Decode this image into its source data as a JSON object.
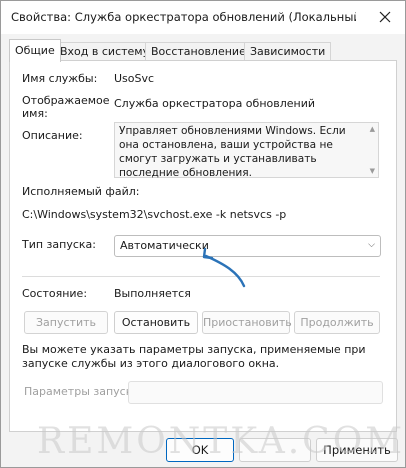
{
  "window": {
    "title": "Свойства: Служба оркестратора обновлений (Локальный компьютер)",
    "close_icon": "close-icon"
  },
  "tabs": [
    {
      "label": "Общие"
    },
    {
      "label": "Вход в систему"
    },
    {
      "label": "Восстановление"
    },
    {
      "label": "Зависимости"
    }
  ],
  "general": {
    "service_name_label": "Имя службы:",
    "service_name_value": "UsoSvc",
    "display_name_label_1": "Отображаемое",
    "display_name_label_2": "имя:",
    "display_name_value": "Служба оркестратора обновлений",
    "description_label": "Описание:",
    "description_value": "Управляет обновлениями Windows. Если она остановлена, ваши устройства не смогут загружать и устанавливать последние обновления.",
    "exe_label": "Исполняемый файл:",
    "exe_value": "C:\\Windows\\system32\\svchost.exe -k netsvcs -p",
    "startup_type_label": "Тип запуска:",
    "startup_type_value": "Автоматически",
    "status_label": "Состояние:",
    "status_value": "Выполняется",
    "buttons": {
      "start": "Запустить",
      "stop": "Остановить",
      "pause": "Приостановить",
      "resume": "Продолжить"
    },
    "params_hint": "Вы можете указать параметры запуска, применяемые при запуске службы из этого диалогового окна.",
    "params_label": "Параметры запуска:",
    "params_value": ""
  },
  "footer": {
    "ok": "OK",
    "apply": "Применить"
  },
  "watermark": "REMONTKA.COM",
  "colors": {
    "accent": "#0067c0",
    "arrow": "#2b73b8"
  }
}
